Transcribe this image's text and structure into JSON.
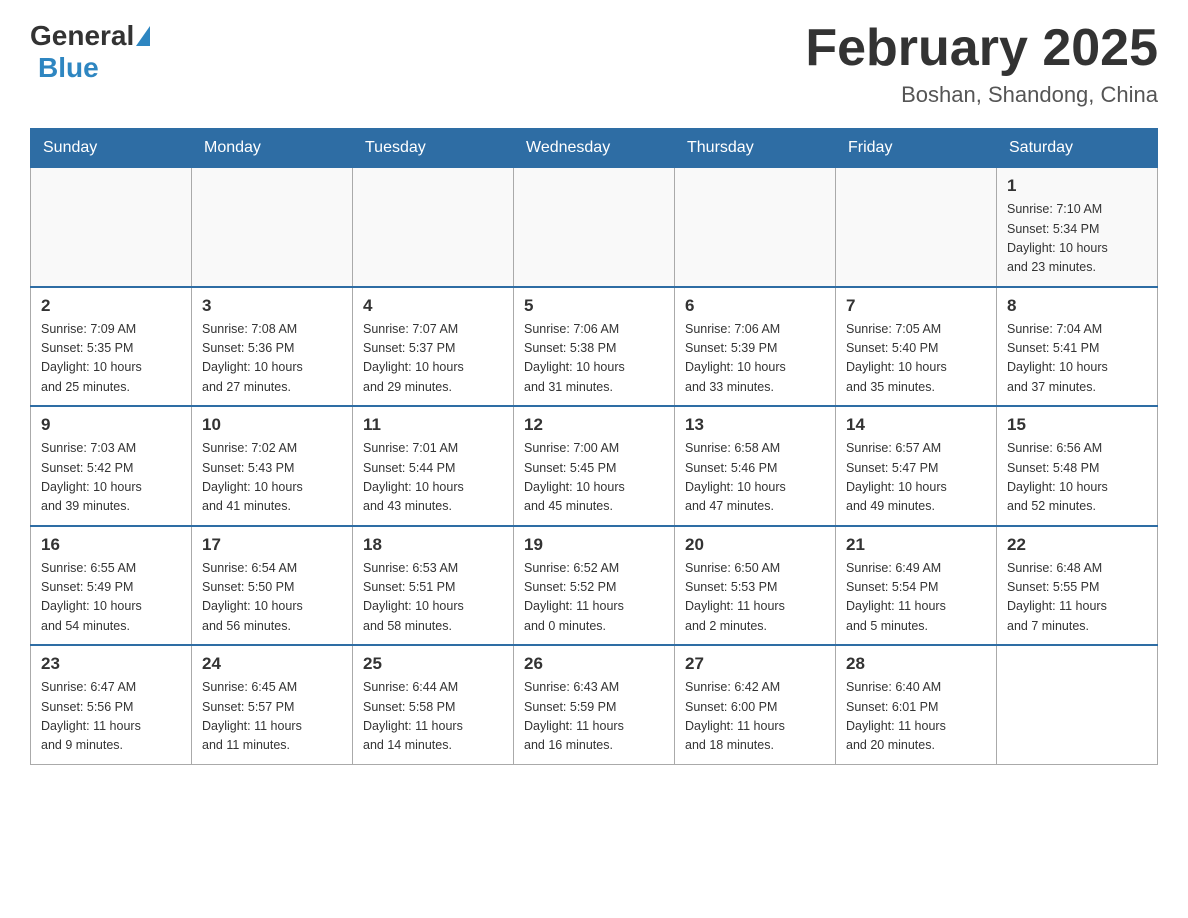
{
  "header": {
    "logo_general": "General",
    "logo_blue": "Blue",
    "month_title": "February 2025",
    "location": "Boshan, Shandong, China"
  },
  "days_of_week": [
    "Sunday",
    "Monday",
    "Tuesday",
    "Wednesday",
    "Thursday",
    "Friday",
    "Saturday"
  ],
  "weeks": [
    [
      {
        "day": "",
        "info": ""
      },
      {
        "day": "",
        "info": ""
      },
      {
        "day": "",
        "info": ""
      },
      {
        "day": "",
        "info": ""
      },
      {
        "day": "",
        "info": ""
      },
      {
        "day": "",
        "info": ""
      },
      {
        "day": "1",
        "info": "Sunrise: 7:10 AM\nSunset: 5:34 PM\nDaylight: 10 hours\nand 23 minutes."
      }
    ],
    [
      {
        "day": "2",
        "info": "Sunrise: 7:09 AM\nSunset: 5:35 PM\nDaylight: 10 hours\nand 25 minutes."
      },
      {
        "day": "3",
        "info": "Sunrise: 7:08 AM\nSunset: 5:36 PM\nDaylight: 10 hours\nand 27 minutes."
      },
      {
        "day": "4",
        "info": "Sunrise: 7:07 AM\nSunset: 5:37 PM\nDaylight: 10 hours\nand 29 minutes."
      },
      {
        "day": "5",
        "info": "Sunrise: 7:06 AM\nSunset: 5:38 PM\nDaylight: 10 hours\nand 31 minutes."
      },
      {
        "day": "6",
        "info": "Sunrise: 7:06 AM\nSunset: 5:39 PM\nDaylight: 10 hours\nand 33 minutes."
      },
      {
        "day": "7",
        "info": "Sunrise: 7:05 AM\nSunset: 5:40 PM\nDaylight: 10 hours\nand 35 minutes."
      },
      {
        "day": "8",
        "info": "Sunrise: 7:04 AM\nSunset: 5:41 PM\nDaylight: 10 hours\nand 37 minutes."
      }
    ],
    [
      {
        "day": "9",
        "info": "Sunrise: 7:03 AM\nSunset: 5:42 PM\nDaylight: 10 hours\nand 39 minutes."
      },
      {
        "day": "10",
        "info": "Sunrise: 7:02 AM\nSunset: 5:43 PM\nDaylight: 10 hours\nand 41 minutes."
      },
      {
        "day": "11",
        "info": "Sunrise: 7:01 AM\nSunset: 5:44 PM\nDaylight: 10 hours\nand 43 minutes."
      },
      {
        "day": "12",
        "info": "Sunrise: 7:00 AM\nSunset: 5:45 PM\nDaylight: 10 hours\nand 45 minutes."
      },
      {
        "day": "13",
        "info": "Sunrise: 6:58 AM\nSunset: 5:46 PM\nDaylight: 10 hours\nand 47 minutes."
      },
      {
        "day": "14",
        "info": "Sunrise: 6:57 AM\nSunset: 5:47 PM\nDaylight: 10 hours\nand 49 minutes."
      },
      {
        "day": "15",
        "info": "Sunrise: 6:56 AM\nSunset: 5:48 PM\nDaylight: 10 hours\nand 52 minutes."
      }
    ],
    [
      {
        "day": "16",
        "info": "Sunrise: 6:55 AM\nSunset: 5:49 PM\nDaylight: 10 hours\nand 54 minutes."
      },
      {
        "day": "17",
        "info": "Sunrise: 6:54 AM\nSunset: 5:50 PM\nDaylight: 10 hours\nand 56 minutes."
      },
      {
        "day": "18",
        "info": "Sunrise: 6:53 AM\nSunset: 5:51 PM\nDaylight: 10 hours\nand 58 minutes."
      },
      {
        "day": "19",
        "info": "Sunrise: 6:52 AM\nSunset: 5:52 PM\nDaylight: 11 hours\nand 0 minutes."
      },
      {
        "day": "20",
        "info": "Sunrise: 6:50 AM\nSunset: 5:53 PM\nDaylight: 11 hours\nand 2 minutes."
      },
      {
        "day": "21",
        "info": "Sunrise: 6:49 AM\nSunset: 5:54 PM\nDaylight: 11 hours\nand 5 minutes."
      },
      {
        "day": "22",
        "info": "Sunrise: 6:48 AM\nSunset: 5:55 PM\nDaylight: 11 hours\nand 7 minutes."
      }
    ],
    [
      {
        "day": "23",
        "info": "Sunrise: 6:47 AM\nSunset: 5:56 PM\nDaylight: 11 hours\nand 9 minutes."
      },
      {
        "day": "24",
        "info": "Sunrise: 6:45 AM\nSunset: 5:57 PM\nDaylight: 11 hours\nand 11 minutes."
      },
      {
        "day": "25",
        "info": "Sunrise: 6:44 AM\nSunset: 5:58 PM\nDaylight: 11 hours\nand 14 minutes."
      },
      {
        "day": "26",
        "info": "Sunrise: 6:43 AM\nSunset: 5:59 PM\nDaylight: 11 hours\nand 16 minutes."
      },
      {
        "day": "27",
        "info": "Sunrise: 6:42 AM\nSunset: 6:00 PM\nDaylight: 11 hours\nand 18 minutes."
      },
      {
        "day": "28",
        "info": "Sunrise: 6:40 AM\nSunset: 6:01 PM\nDaylight: 11 hours\nand 20 minutes."
      },
      {
        "day": "",
        "info": ""
      }
    ]
  ]
}
